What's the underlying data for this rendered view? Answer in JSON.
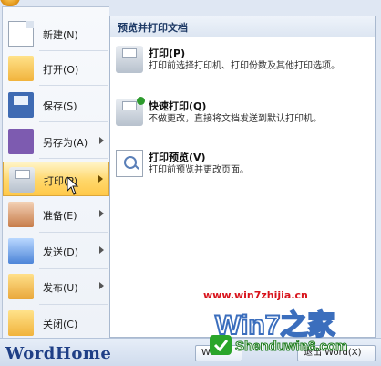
{
  "left_menu": {
    "items": [
      {
        "label": "新建(N)",
        "icon": "new-doc-icon",
        "arrow": false
      },
      {
        "label": "打开(O)",
        "icon": "folder-open-icon",
        "arrow": false
      },
      {
        "label": "保存(S)",
        "icon": "save-disk-icon",
        "arrow": false
      },
      {
        "label": "另存为(A)",
        "icon": "save-as-icon",
        "arrow": true
      },
      {
        "label": "打印(P)",
        "icon": "printer-icon",
        "arrow": true,
        "hover": true
      },
      {
        "label": "准备(E)",
        "icon": "prepare-icon",
        "arrow": true
      },
      {
        "label": "发送(D)",
        "icon": "send-icon",
        "arrow": true
      },
      {
        "label": "发布(U)",
        "icon": "publish-icon",
        "arrow": true
      },
      {
        "label": "关闭(C)",
        "icon": "close-folder-icon",
        "arrow": false
      }
    ]
  },
  "right_panel": {
    "title": "预览并打印文档",
    "options": [
      {
        "title": "打印(P)",
        "desc": "打印前选择打印机、打印份数及其他打印选项。",
        "icon": "printer-icon"
      },
      {
        "title": "快速打印(Q)",
        "desc": "不做更改，直接将文档发送到默认打印机。",
        "icon": "quick-print-icon"
      },
      {
        "title": "打印预览(V)",
        "desc": "打印前预览并更改页面。",
        "icon": "print-preview-icon"
      }
    ]
  },
  "bottom": {
    "brand": "WordHome",
    "btn_word": "Word",
    "btn_exit": "退出 Word(X)"
  },
  "watermarks": {
    "url": "www.win7zhijia.cn",
    "win7": "Win7之家",
    "shenduwin8": "Shenduwin8.com"
  },
  "colors": {
    "accent": "#ffd76a",
    "brand": "#1f3f86",
    "watermark_red": "#d8141c"
  }
}
